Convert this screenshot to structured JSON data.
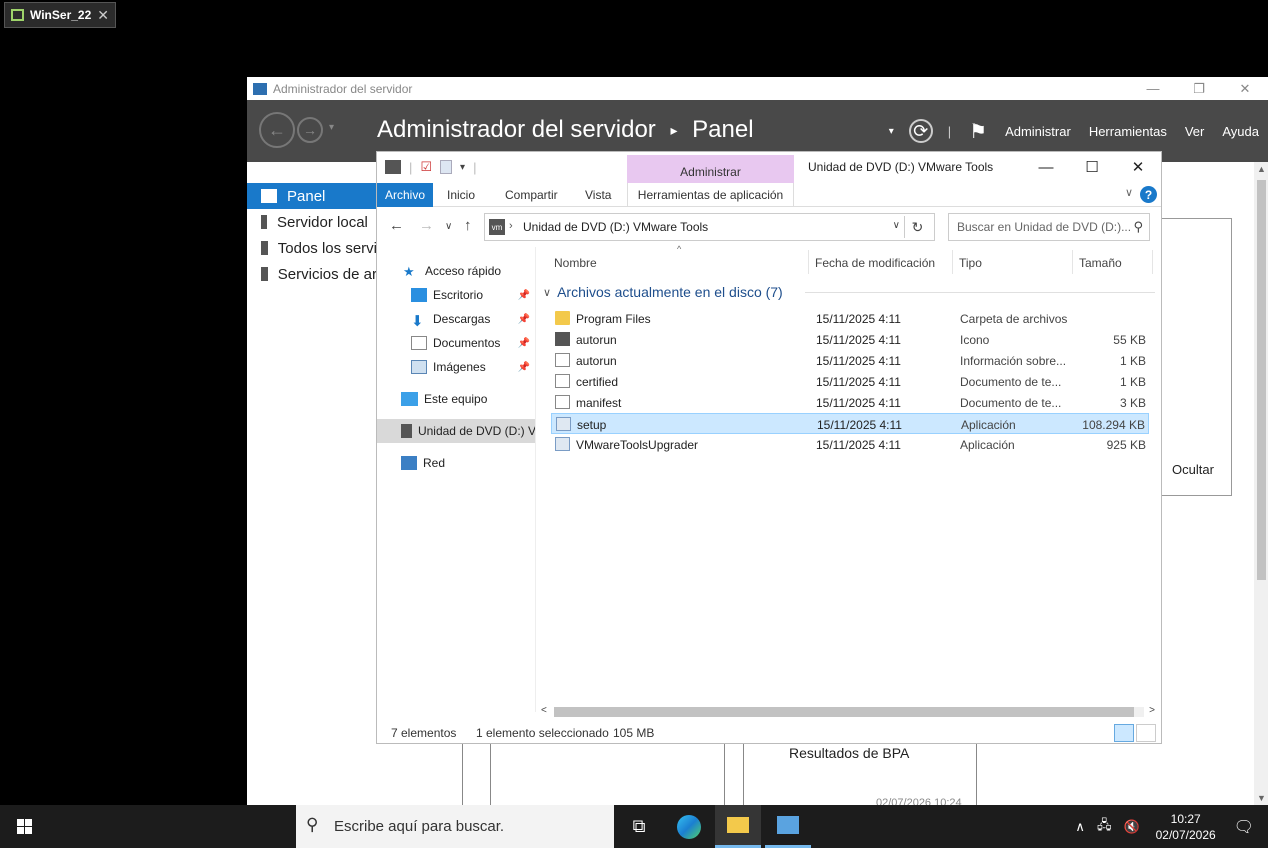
{
  "vm_tab": {
    "title": "WinSer_22"
  },
  "server_manager": {
    "window_title": "Administrador del servidor",
    "breadcrumb": {
      "root": "Administrador del servidor",
      "current": "Panel"
    },
    "menu": [
      "Administrar",
      "Herramientas",
      "Ver",
      "Ayuda"
    ],
    "sidebar": [
      {
        "label": "Panel",
        "selected": true
      },
      {
        "label": "Servidor local"
      },
      {
        "label": "Todos los servi"
      },
      {
        "label": "Servicios de ar"
      }
    ],
    "hide_label": "Ocultar",
    "bpa_label": "Resultados de BPA",
    "bpa_date": "02/07/2026 10:24"
  },
  "explorer": {
    "title": "Unidad de DVD (D:) VMware Tools",
    "context_tab": "Administrar",
    "ribbon_tabs": [
      "Archivo",
      "Inicio",
      "Compartir",
      "Vista",
      "Herramientas de aplicación"
    ],
    "address": "Unidad de DVD (D:) VMware Tools",
    "search_placeholder": "Buscar en Unidad de DVD (D:)...",
    "nav": [
      {
        "label": "Acceso rápido",
        "icon": "star-icon"
      },
      {
        "label": "Escritorio",
        "icon": "desktop-icon",
        "pinned": true
      },
      {
        "label": "Descargas",
        "icon": "download-icon",
        "pinned": true
      },
      {
        "label": "Documentos",
        "icon": "documents-icon",
        "pinned": true
      },
      {
        "label": "Imágenes",
        "icon": "pictures-icon",
        "pinned": true
      },
      {
        "label": "Este equipo",
        "icon": "computer-icon"
      },
      {
        "label": "Unidad de DVD (D:) V",
        "icon": "dvd-drive-icon",
        "selected": true
      },
      {
        "label": "Red",
        "icon": "network-icon"
      }
    ],
    "columns": [
      "Nombre",
      "Fecha de modificación",
      "Tipo",
      "Tamaño"
    ],
    "group_header": "Archivos actualmente en el disco (7)",
    "files": [
      {
        "name": "Program Files",
        "date": "15/11/2025 4:11",
        "type": "Carpeta de archivos",
        "size": "",
        "icon": "folder"
      },
      {
        "name": "autorun",
        "date": "15/11/2025 4:11",
        "type": "Icono",
        "size": "55 KB",
        "icon": "vm"
      },
      {
        "name": "autorun",
        "date": "15/11/2025 4:11",
        "type": "Información sobre...",
        "size": "1 KB",
        "icon": "doc"
      },
      {
        "name": "certified",
        "date": "15/11/2025 4:11",
        "type": "Documento de te...",
        "size": "1 KB",
        "icon": "doc"
      },
      {
        "name": "manifest",
        "date": "15/11/2025 4:11",
        "type": "Documento de te...",
        "size": "3 KB",
        "icon": "doc"
      },
      {
        "name": "setup",
        "date": "15/11/2025 4:11",
        "type": "Aplicación",
        "size": "108.294 KB",
        "icon": "app",
        "selected": true
      },
      {
        "name": "VMwareToolsUpgrader",
        "date": "15/11/2025 4:11",
        "type": "Aplicación",
        "size": "925 KB",
        "icon": "app"
      }
    ],
    "status": {
      "count": "7 elementos",
      "selection": "1 elemento seleccionado",
      "size": "105 MB"
    }
  },
  "taskbar": {
    "search_placeholder": "Escribe aquí para buscar.",
    "time": "10:27",
    "date": "02/07/2026"
  }
}
